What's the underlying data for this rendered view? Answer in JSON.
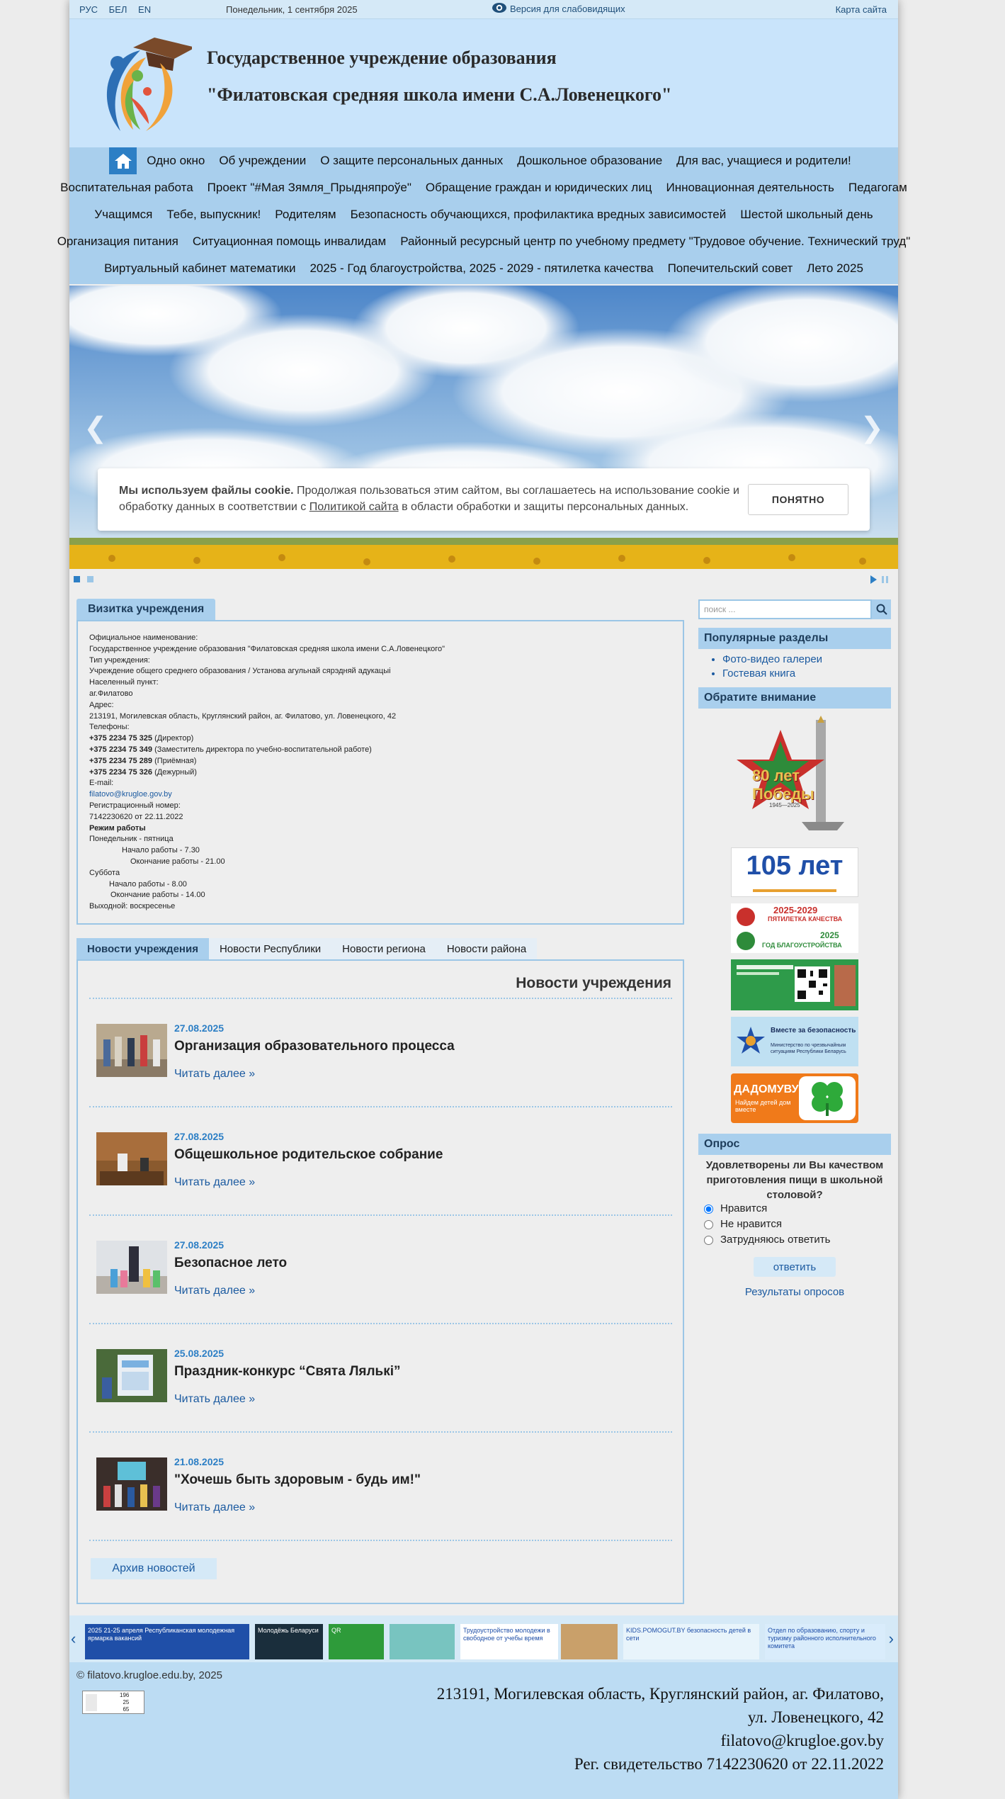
{
  "topbar": {
    "languages": [
      "РУС",
      "БЕЛ",
      "EN"
    ],
    "date": "Понедельник, 1 сентября 2025",
    "accessibility_link": "Версия для слабовидящих",
    "sitemap_link": "Карта сайта"
  },
  "header": {
    "title_line1": "Государственное учреждение образования",
    "title_line2": "\"Филатовская средняя школа имени С.А.Ловенецкого\""
  },
  "nav": {
    "rows": [
      [
        "Одно окно",
        "Об учреждении",
        "О защите персональных данных",
        "Дошкольное образование",
        "Для вас, учащиеся и родители!"
      ],
      [
        "Воспитательная работа",
        "Проект \"#Мая Зямля_Прыдняпроўе\"",
        "Обращение граждан и юридических лиц",
        "Инновационная деятельность",
        "Педагогам"
      ],
      [
        "Учащимся",
        "Тебе, выпускник!",
        "Родителям",
        "Безопасность обучающихся, профилактика вредных зависимостей",
        "Шестой школьный день"
      ],
      [
        "Организация питания",
        "Ситуационная помощь инвалидам",
        "Районный ресурсный центр по учебному предмету \"Трудовое обучение. Технический труд\""
      ],
      [
        "Виртуальный кабинет математики",
        "2025 - Год благоустройства, 2025 - 2029 - пятилетка качества",
        "Попечительский совет",
        "Лето 2025"
      ]
    ]
  },
  "cookie": {
    "bold": "Мы используем файлы cookie.",
    "text1": " Продолжая пользоваться этим сайтом, вы соглашаетесь на использование cookie и обработку данных в соответствии с ",
    "link": "Политикой сайта",
    "text2": " в области обработки и защиты персональных данных.",
    "button": "ПОНЯТНО"
  },
  "vizit": {
    "tab": "Визитка учреждения",
    "lines": [
      {
        "t": "Официальное наименование:"
      },
      {
        "t": "Государственное учреждение образования \"Филатовская средняя школа имени С.А.Ловенецкого\""
      },
      {
        "t": "Тип учреждения:"
      },
      {
        "t": "Учреждение общего среднего образования / Установа агульнай сярэдняй адукацыі"
      },
      {
        "t": "Населенный пункт:"
      },
      {
        "t": "аг.Филатово"
      },
      {
        "t": "Адрес:"
      },
      {
        "t": "213191, Могилевская область, Круглянский район, аг. Филатово, ул. Ловенецкого, 42"
      },
      {
        "t": "Телефоны:"
      },
      {
        "b": "+375 2234 75 325",
        "t": " (Директор)"
      },
      {
        "b": "+375 2234 75 349",
        "t": " (Заместитель директора по учебно-воспитательной работе)"
      },
      {
        "b": "+375 2234 75 289",
        "t": " (Приёмная)"
      },
      {
        "b": "+375 2234 75 326",
        "t": " (Дежурный)"
      },
      {
        "t": "E-mail:"
      },
      {
        "link": "filatovo@krugloe.gov.by"
      },
      {
        "t": "Регистрационный номер:"
      },
      {
        "t": "7142230620 от 22.11.2022"
      },
      {
        "b": "Режим работы"
      },
      {
        "t": "Понедельник - пятница"
      },
      {
        "t": "Начало работы - 7.30",
        "indent": 1
      },
      {
        "t": "Окончание работы - 21.00",
        "indent": 2
      },
      {
        "t": "Суббота"
      },
      {
        "t": "Начало работы - 8.00",
        "indent": 3
      },
      {
        "t": "Окончание работы - 14.00",
        "indent": 4
      },
      {
        "t": "Выходной: воскресенье"
      }
    ]
  },
  "news": {
    "tabs": [
      "Новости учреждения",
      "Новости Республики",
      "Новости региона",
      "Новости района"
    ],
    "heading": "Новости учреждения",
    "read_more": "Читать далее »",
    "items": [
      {
        "date": "27.08.2025",
        "title": "Организация образовательного процесса"
      },
      {
        "date": "27.08.2025",
        "title": "Общешкольное родительское собрание"
      },
      {
        "date": "27.08.2025",
        "title": "Безопасное лето"
      },
      {
        "date": "25.08.2025",
        "title": "Праздник-конкурс “Свята Лялькі”"
      },
      {
        "date": "21.08.2025",
        "title": "\"Хочешь быть здоровым - будь им!\""
      }
    ],
    "archive": "Архив новостей"
  },
  "sidebar": {
    "search_placeholder": "поиск ...",
    "popular_title": "Популярные разделы",
    "popular_links": [
      "Фото-видео галереи",
      "Гостевая книга"
    ],
    "attention_title": "Обратите внимание",
    "banner_texts": {
      "victory": "80 лет Победы",
      "victory_years": "1945—2025",
      "edu105": "105 лет",
      "quality_years": "2025-2029",
      "quality": "ПЯТИЛЕТКА КАЧЕСТВА",
      "improve_year": "2025",
      "improve": "ГОД БЛАГОУСТРОЙСТВА",
      "safety": "Вместе за безопасность",
      "ministry": "Министерство по чрезвычайным ситуациям Республики Беларусь",
      "home": "ДАДОМУВУ",
      "home_sub": "Найдем детей дом вместе"
    },
    "poll": {
      "title": "Опрос",
      "question": "Удовлетворены ли Вы качеством приготовления пищи в школьной столовой?",
      "options": [
        "Нравится",
        "Не нравится",
        "Затрудняюсь ответить"
      ],
      "selected": 0,
      "submit": "ответить",
      "results": "Результаты опросов"
    }
  },
  "banner_strip": {
    "items": [
      {
        "text": "2025 21-25 апреля Республиканская молодежная ярмарка вакансий",
        "color": "#1f4fa8"
      },
      {
        "text": "Молодёжь Беларуси",
        "color": "#1a2e3c"
      },
      {
        "text": "QR",
        "color": "#2e9b3a"
      },
      {
        "text": "",
        "color": "#78c4c0"
      },
      {
        "text": "Трудоустройство молодежи в свободное от учебы время",
        "color": "#ffffff"
      },
      {
        "text": "",
        "color": "#c9a06a"
      },
      {
        "text": "KIDS.POMOGUT.BY безопасность детей в сети",
        "color": "#e8f4fb"
      },
      {
        "text": "Отдел по образованию, спорту и туризму районного исполнительного комитета",
        "color": "#d9ecfb"
      }
    ]
  },
  "footer": {
    "copyright": "© filatovo.krugloe.edu.by, 2025",
    "counter": [
      "196",
      "25",
      "65"
    ],
    "address_line1": "213191, Могилевская область, Круглянский район, аг. Филатово,",
    "address_line2": "ул. Ловенецкого, 42",
    "email": "filatovo@krugloe.gov.by",
    "reg": "Рег. свидетельство 7142230620 от 22.11.2022"
  }
}
